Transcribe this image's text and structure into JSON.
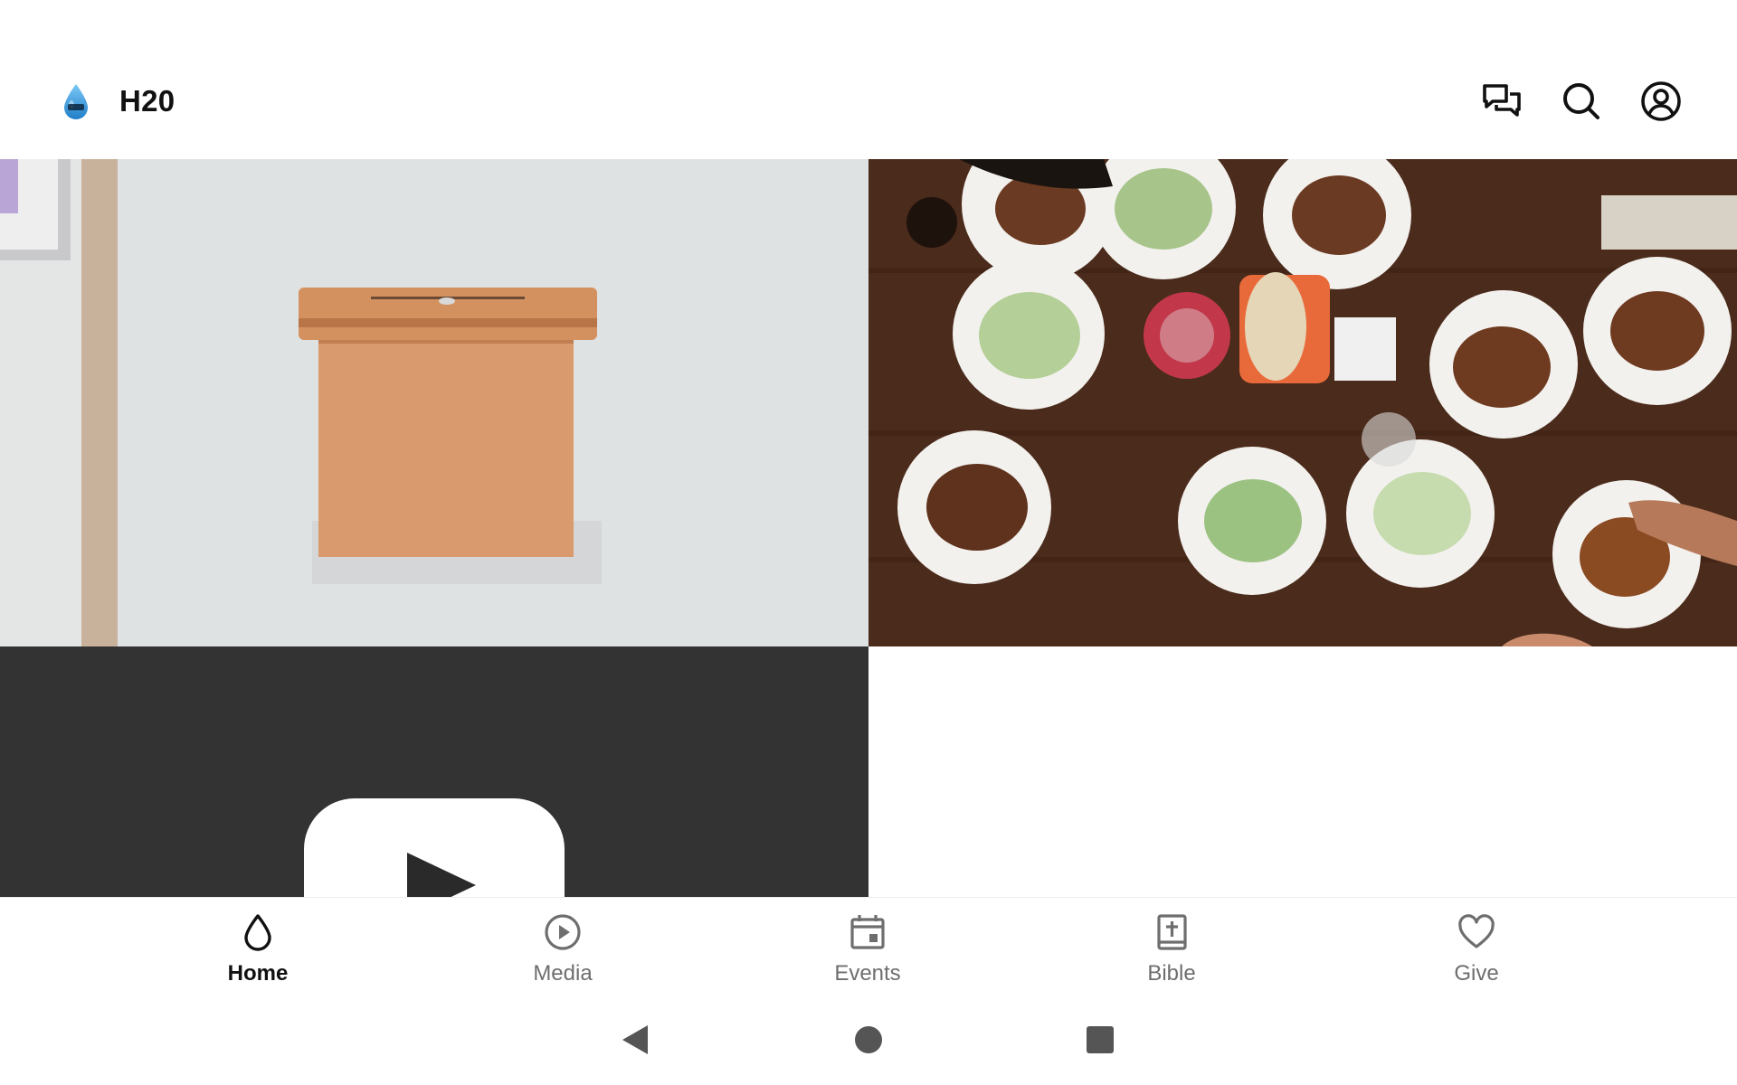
{
  "app_bar": {
    "title": "H20",
    "logo_icon": "water-drop-logo",
    "actions": [
      {
        "name": "chat-icon"
      },
      {
        "name": "search-icon"
      },
      {
        "name": "account-icon"
      }
    ]
  },
  "content": {
    "tiles": [
      {
        "name": "offering-box-photo"
      },
      {
        "name": "shared-meal-photo"
      },
      {
        "name": "youtube-video-tile",
        "icon": "youtube-play-icon"
      }
    ]
  },
  "bottom_nav": {
    "items": [
      {
        "label": "Home",
        "icon": "drop-icon",
        "active": true
      },
      {
        "label": "Media",
        "icon": "play-circle-icon",
        "active": false
      },
      {
        "label": "Events",
        "icon": "calendar-icon",
        "active": false
      },
      {
        "label": "Bible",
        "icon": "bible-icon",
        "active": false
      },
      {
        "label": "Give",
        "icon": "heart-icon",
        "active": false
      }
    ]
  },
  "system_nav": [
    "back-icon",
    "home-icon",
    "recents-icon"
  ],
  "colors": {
    "accent": "#111111",
    "inactive": "#6e6e6e",
    "video_bg": "#333333",
    "logo_blue": "#2a8fd6"
  }
}
